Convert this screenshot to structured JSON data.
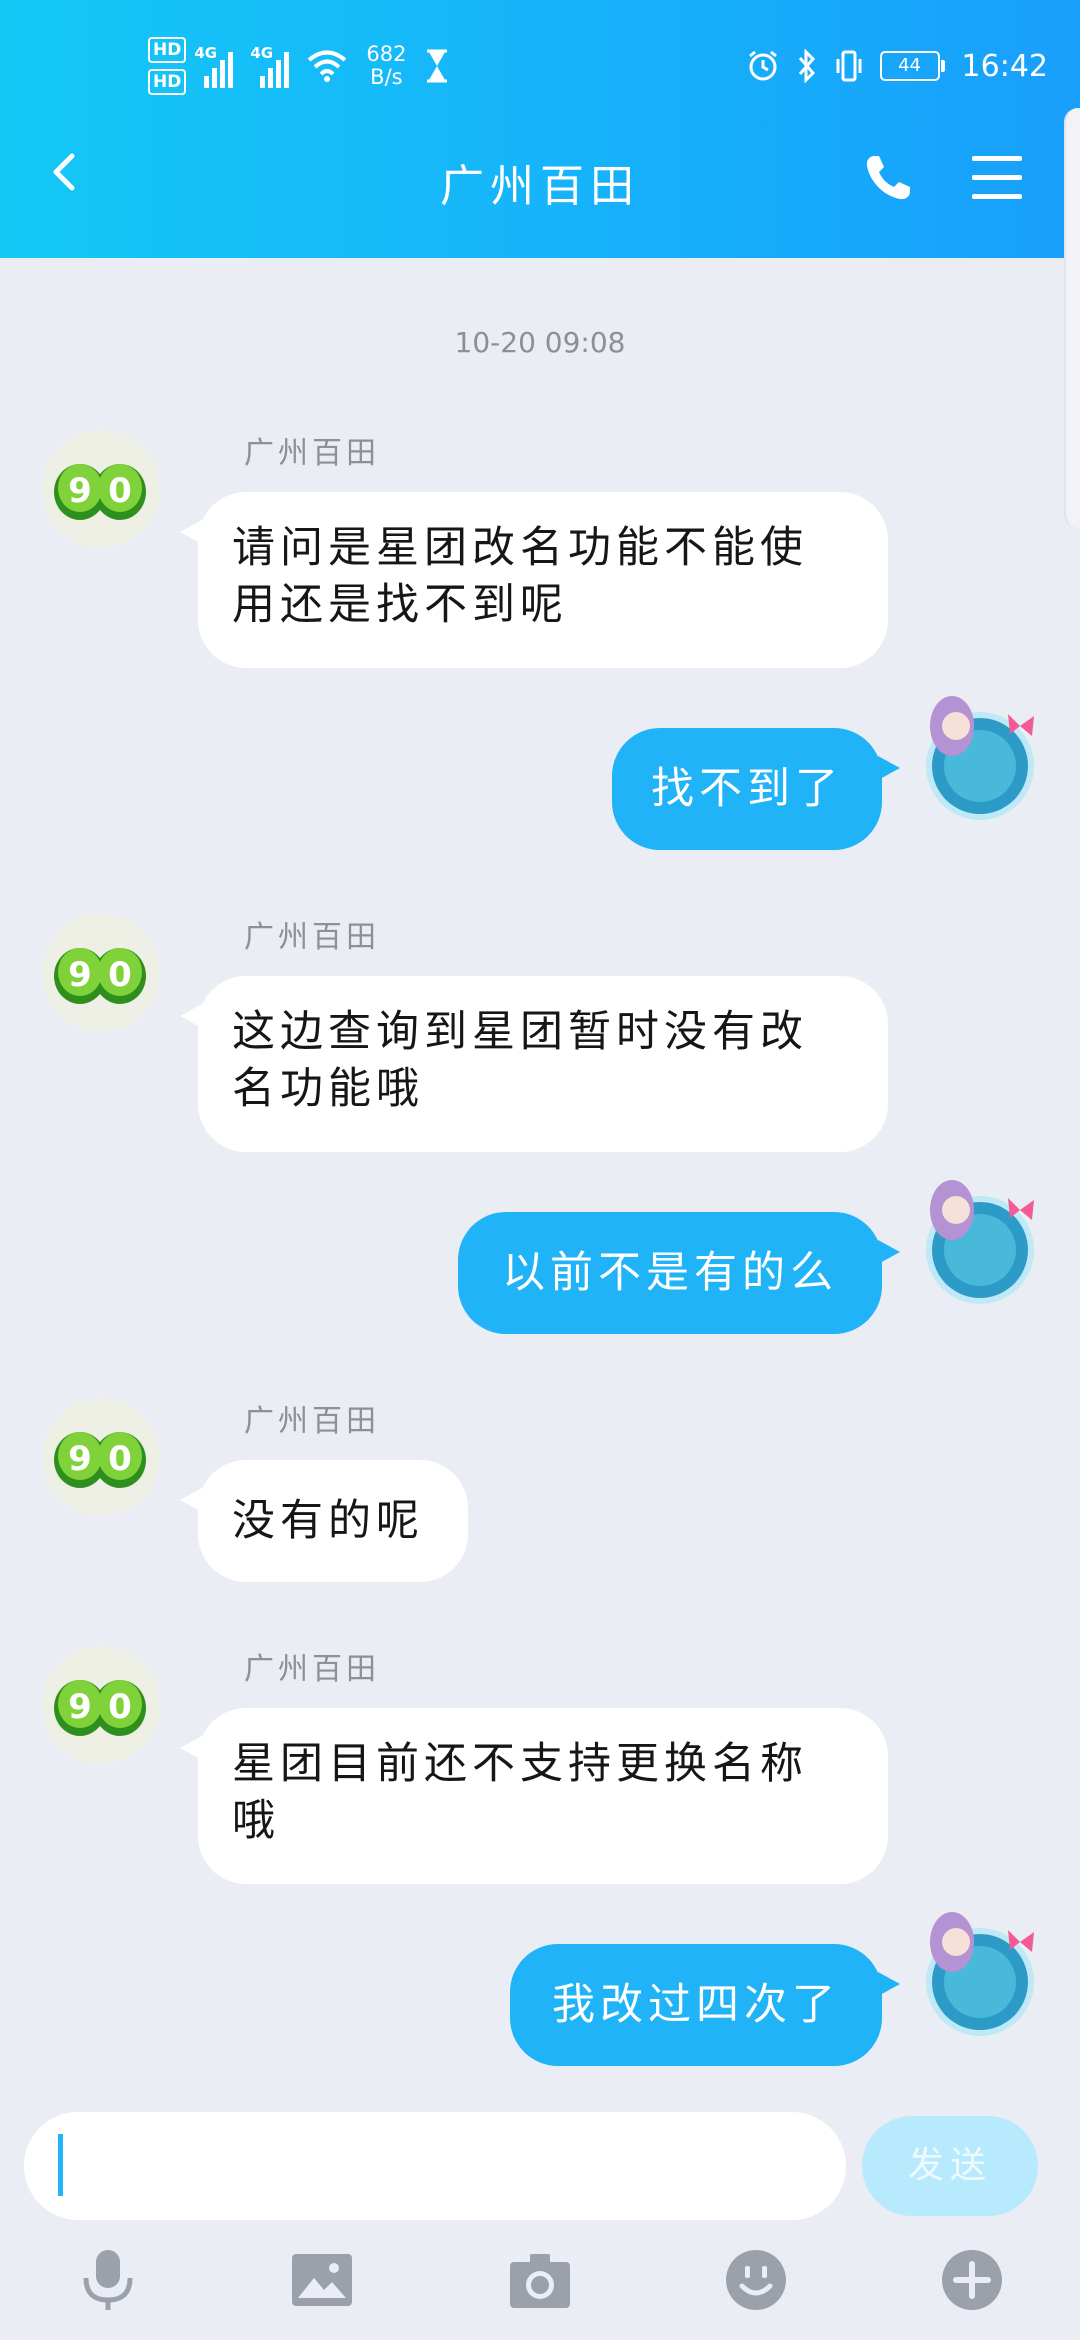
{
  "status_bar": {
    "hd1": "HD",
    "hd2": "HD",
    "net1": "4G",
    "net2": "4G",
    "rate_value": "682",
    "rate_unit": "B/s",
    "battery": "44",
    "time": "16:42"
  },
  "header": {
    "title": "广州百田"
  },
  "chat": {
    "timestamp": "10-20 09:08",
    "messages": [
      {
        "side": "in",
        "nick": "广州百田",
        "text": "请问是星团改名功能不能使用还是找不到呢"
      },
      {
        "side": "out",
        "text": "找不到了"
      },
      {
        "side": "in",
        "nick": "广州百田",
        "text": "这边查询到星团暂时没有改名功能哦"
      },
      {
        "side": "out",
        "text": "以前不是有的么"
      },
      {
        "side": "in",
        "nick": "广州百田",
        "text": "没有的呢"
      },
      {
        "side": "in",
        "nick": "广州百田",
        "text": "星团目前还不支持更换名称哦"
      },
      {
        "side": "out",
        "text": "我改过四次了"
      }
    ]
  },
  "input": {
    "value": "",
    "send_label": "发送"
  },
  "toolbar": {
    "items": [
      "mic-icon",
      "image-icon",
      "camera-icon",
      "emoji-icon",
      "plus-icon"
    ]
  },
  "colors": {
    "header_start": "#14c8f6",
    "header_end": "#189ffb",
    "outgoing_bubble": "#20b3f7",
    "incoming_bubble": "#ffffff",
    "background": "#eaedf4",
    "send_button": "#b8eafd"
  }
}
